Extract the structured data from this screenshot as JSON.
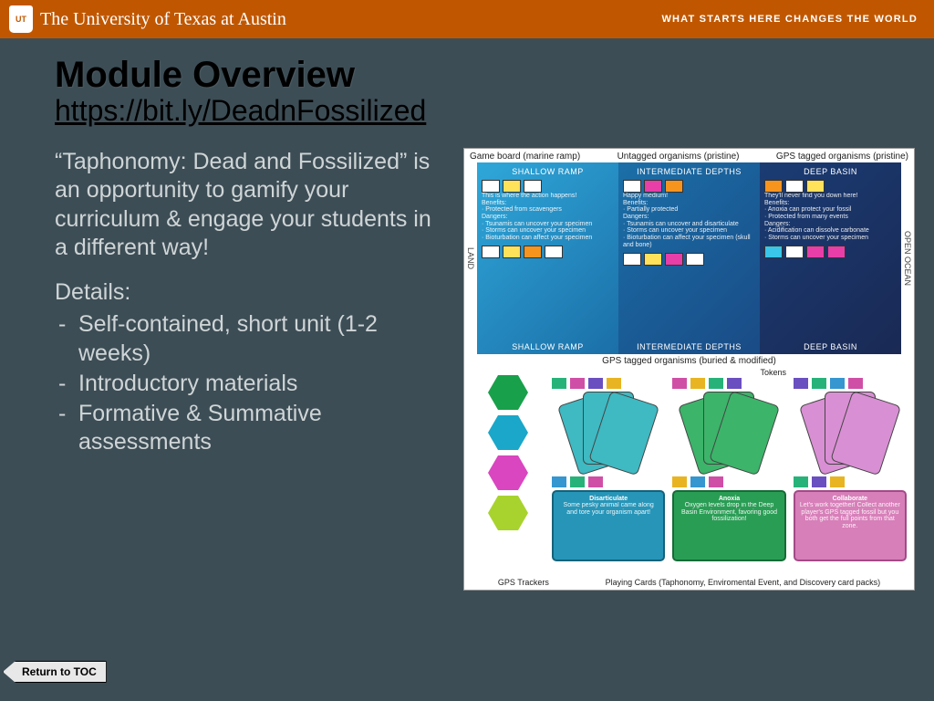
{
  "header": {
    "university": "The University of Texas at Austin",
    "tagline": "WHAT STARTS HERE CHANGES THE WORLD"
  },
  "page": {
    "title": "Module Overview",
    "url": "https://bit.ly/DeadnFossilized"
  },
  "body": {
    "description": "“Taphonomy: Dead and Fossilized” is an opportunity to gamify your curriculum & engage your students in a different way!",
    "details_label": "Details:",
    "bullets": [
      "Self-contained, short unit (1-2 weeks)",
      "Introductory materials",
      "Formative & Summative assessments"
    ]
  },
  "diagram": {
    "top_labels": {
      "left": "Game board (marine ramp)",
      "mid": "Untagged organisms (pristine)",
      "right": "GPS tagged organisms (pristine)"
    },
    "side_left": "LAND",
    "side_right": "OPEN OCEAN",
    "panels": {
      "p1_top": "SHALLOW RAMP",
      "p1_bottom": "SHALLOW RAMP",
      "p2_top": "INTERMEDIATE DEPTHS",
      "p2_bottom": "INTERMEDIATE DEPTHS",
      "p3_top": "DEEP BASIN",
      "p3_bottom": "DEEP BASIN"
    },
    "mid_label": "GPS tagged organisms (buried & modified)",
    "tokens_label": "Tokens",
    "info_cards": {
      "c1_title": "Disarticulate",
      "c2_title": "Anoxia",
      "c3_title": "Collaborate"
    },
    "bottom": {
      "left": "GPS Trackers",
      "right": "Playing Cards (Taphonomy, Enviromental Event, and Discovery card packs)"
    }
  },
  "nav": {
    "return": "Return to TOC"
  }
}
